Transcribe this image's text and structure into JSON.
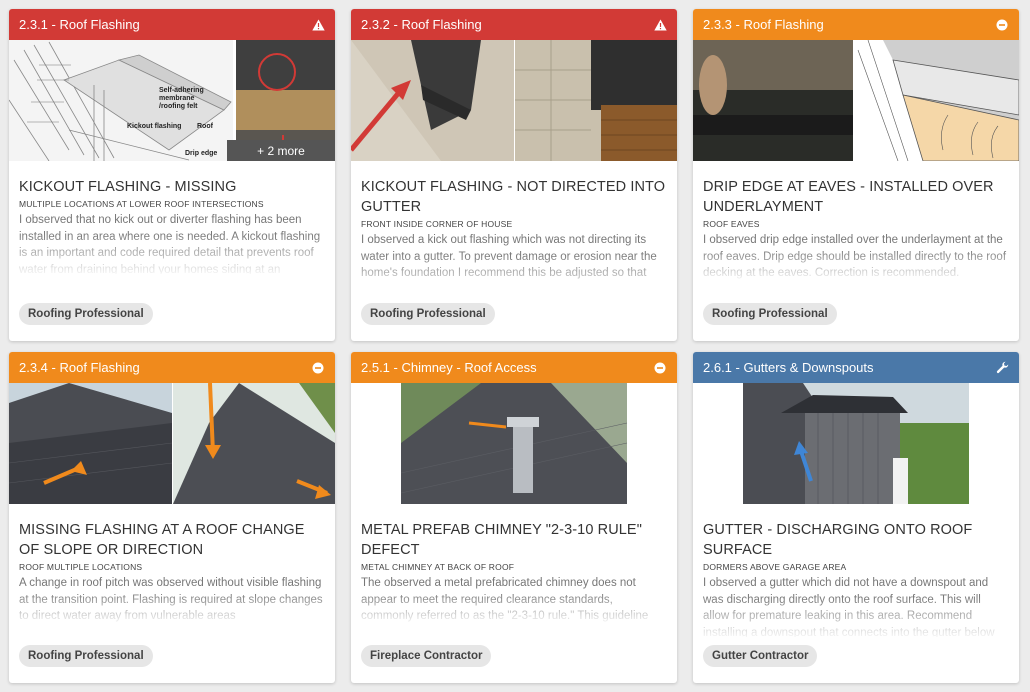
{
  "colors": {
    "safety_red": "#d23a36",
    "defect_orange": "#f08a1c",
    "maintenance_blue": "#4a78a8"
  },
  "cards": [
    {
      "header": "2.3.1 - Roof Flashing",
      "icon": "warning-icon",
      "title": "KICKOUT FLASHING - MISSING",
      "location": "MULTIPLE LOCATIONS AT LOWER ROOF INTERSECTIONS",
      "description": " I observed that no kick out or diverter flashing has been installed in an area where one is needed. A kickout flashing is an important and code required detail that prevents roof water from draining behind your homes siding at an",
      "contractor": "Roofing Professional",
      "more": "+ 2 more",
      "diagram_labels": [
        "Self-adhering membrane /roofing felt",
        "Kickout flashing",
        "Roof",
        "Drip edge"
      ]
    },
    {
      "header": "2.3.2 - Roof Flashing",
      "icon": "warning-icon",
      "title": "KICKOUT FLASHING - NOT DIRECTED INTO GUTTER",
      "location": "FRONT INSIDE CORNER OF HOUSE",
      "description": "I observed a kick out flashing which was not directing its water into a gutter. To prevent damage or erosion near the home's foundation I recommend this be adjusted so that",
      "contractor": "Roofing Professional"
    },
    {
      "header": "2.3.3 - Roof Flashing",
      "icon": "minus-circle-icon",
      "title": "DRIP EDGE AT EAVES - INSTALLED OVER UNDERLAYMENT",
      "location": "ROOF EAVES",
      "description": "I observed drip edge installed over the underlayment at the roof eaves. Drip edge should be installed directly to the roof decking at the eaves. Correction is recommended.",
      "contractor": "Roofing Professional"
    },
    {
      "header": "2.3.4 - Roof Flashing",
      "icon": "minus-circle-icon",
      "title": "MISSING FLASHING AT A ROOF CHANGE OF SLOPE OR DIRECTION",
      "location": "ROOF MULTIPLE LOCATIONS",
      "description": "A change in roof pitch was observed without visible flashing at the transition point. Flashing is required at slope changes to direct water away from vulnerable areas",
      "contractor": "Roofing Professional"
    },
    {
      "header": "2.5.1 - Chimney - Roof Access",
      "icon": "minus-circle-icon",
      "title": "METAL PREFAB CHIMNEY \"2-3-10 RULE\" DEFECT",
      "location": "METAL CHIMNEY AT BACK OF ROOF",
      "description": "The observed a metal prefabricated chimney does not appear to meet the required clearance standards, commonly referred to as the \"2-3-10 rule.\" This guideline",
      "contractor": "Fireplace Contractor"
    },
    {
      "header": "2.6.1 - Gutters & Downspouts",
      "icon": "wrench-icon",
      "title": "GUTTER - DISCHARGING ONTO ROOF SURFACE",
      "location": "DORMERS ABOVE GARAGE AREA",
      "description": "I observed a gutter which did not have a downspout and was discharging directly onto the roof surface. This will allow for premature leaking in this area. Recommend installing a downspout that connects into the gutter below",
      "contractor": "Gutter Contractor"
    }
  ]
}
